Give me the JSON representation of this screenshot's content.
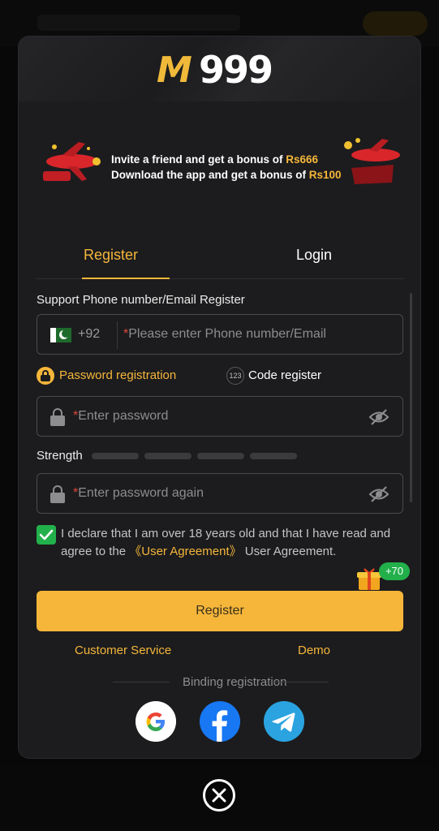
{
  "brand": {
    "logo_m": "M",
    "logo_num": "999"
  },
  "banner": {
    "line1_prefix": "Invite a friend and get a bonus of ",
    "line1_amount": "Rs666",
    "line2_prefix": "Download the app and get a bonus of ",
    "line2_amount": "Rs100"
  },
  "tabs": [
    {
      "label": "Register",
      "active": true
    },
    {
      "label": "Login",
      "active": false
    }
  ],
  "form": {
    "support_label": "Support Phone number/Email Register",
    "country_code": "+92",
    "phone_placeholder": "Please enter Phone number/Email",
    "required_mark": "*",
    "mode_password": "Password registration",
    "mode_code_badge": "123",
    "mode_code": "Code register",
    "password_placeholder": "Enter password",
    "strength_label": "Strength",
    "strength_segments": 4,
    "password_again_placeholder": "Enter password again",
    "agree_text_1": "I declare that I am over 18 years old and that I have read and agree to the",
    "agree_link": "《User Agreement》",
    "agree_text_2": " User Agreement.",
    "agree_checked": true,
    "bonus_badge": "+70",
    "submit_label": "Register"
  },
  "links": {
    "customer_service": "Customer Service",
    "demo": "Demo"
  },
  "binding": {
    "label": "Binding registration",
    "providers": [
      {
        "name": "google-icon",
        "color": "#ffffff"
      },
      {
        "name": "facebook-icon",
        "color": "#1877f2"
      },
      {
        "name": "telegram-icon",
        "color": "#2aa3e0"
      }
    ]
  },
  "colors": {
    "accent": "#f5b63a",
    "success": "#22b04b",
    "panel": "#1c1c1e",
    "required": "#e0463a"
  }
}
